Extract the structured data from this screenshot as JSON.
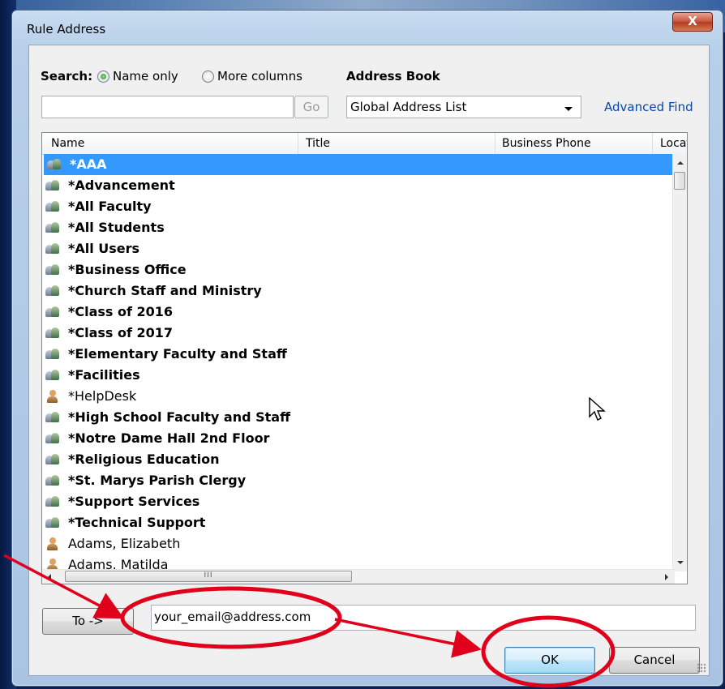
{
  "window": {
    "title": "Rule Address",
    "close_label": "X"
  },
  "search": {
    "label": "Search:",
    "option_name_only": "Name only",
    "option_more_columns": "More columns",
    "selected": "Name only",
    "input_value": "",
    "go_label": "Go"
  },
  "address_book": {
    "label": "Address Book",
    "selected": "Global Address List",
    "advanced_find": "Advanced Find"
  },
  "columns": [
    "Name",
    "Title",
    "Business Phone",
    "Locatio"
  ],
  "entries": [
    {
      "name": "*AAA",
      "type": "group",
      "selected": true
    },
    {
      "name": "*Advancement",
      "type": "group"
    },
    {
      "name": "*All Faculty",
      "type": "group"
    },
    {
      "name": "*All Students",
      "type": "group"
    },
    {
      "name": "*All Users",
      "type": "group"
    },
    {
      "name": "*Business Office",
      "type": "group"
    },
    {
      "name": "*Church Staff and Ministry",
      "type": "group"
    },
    {
      "name": "*Class of 2016",
      "type": "group"
    },
    {
      "name": "*Class of 2017",
      "type": "group"
    },
    {
      "name": "*Elementary Faculty and Staff",
      "type": "group"
    },
    {
      "name": "*Facilities",
      "type": "group"
    },
    {
      "name": "*HelpDesk",
      "type": "user"
    },
    {
      "name": "*High School Faculty and Staff",
      "type": "group"
    },
    {
      "name": "*Notre Dame Hall 2nd Floor",
      "type": "group"
    },
    {
      "name": "*Religious Education",
      "type": "group"
    },
    {
      "name": "*St. Marys Parish Clergy",
      "type": "group"
    },
    {
      "name": "*Support Services",
      "type": "group"
    },
    {
      "name": "*Technical Support",
      "type": "group"
    },
    {
      "name": "Adams, Elizabeth",
      "type": "user"
    },
    {
      "name": "Adams, Matilda",
      "type": "user"
    }
  ],
  "hscroll_thumb_label": "III",
  "to": {
    "button_label": "To ->",
    "value": "your_email@address.com"
  },
  "buttons": {
    "ok": "OK",
    "cancel": "Cancel"
  },
  "colors": {
    "selection": "#3399ff",
    "annotation": "#e0001b",
    "link": "#0645ad"
  }
}
